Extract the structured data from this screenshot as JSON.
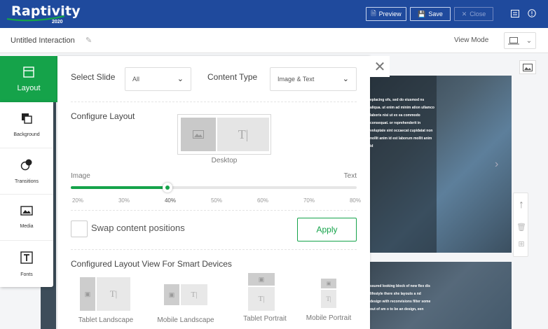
{
  "app": {
    "logo_text": "Raptivity",
    "logo_sub": "2020",
    "preview_label": "Preview",
    "save_label": "Save",
    "close_label": "Close",
    "brand_color": "#1f4a9d",
    "accent_color": "#15a34a"
  },
  "subbar": {
    "title": "Untitled Interaction",
    "view_mode_label": "View Mode"
  },
  "leftnav": {
    "active": {
      "label": "Layout",
      "icon": "layout-icon"
    },
    "items": [
      {
        "label": "Background",
        "icon": "background-icon"
      },
      {
        "label": "Transitions",
        "icon": "transitions-icon"
      },
      {
        "label": "Media",
        "icon": "media-icon"
      },
      {
        "label": "Fonts",
        "icon": "fonts-icon"
      }
    ]
  },
  "panel": {
    "select_slide_label": "Select Slide",
    "select_slide_value": "All",
    "content_type_label": "Content Type",
    "content_type_value": "Image & Text",
    "configure_layout_label": "Configure Layout",
    "desktop_caption": "Desktop",
    "slider": {
      "left_label": "Image",
      "right_label": "Text",
      "ticks": [
        "20%",
        "30%",
        "40%",
        "50%",
        "60%",
        "70%",
        "80%"
      ],
      "value_percent": 40
    },
    "swap_label": "Swap content positions",
    "swap_checked": false,
    "apply_label": "Apply",
    "smart_devices_title": "Configured Layout View For Smart Devices",
    "devices": [
      {
        "label": "Tablet Landscape"
      },
      {
        "label": "Mobile Landscape"
      },
      {
        "label": "Tablet Portrait"
      },
      {
        "label": "Mobile Portrait"
      }
    ],
    "text_glyph": "T|"
  },
  "slides": {
    "slide1_text": "eplacing ofs, sed do eiusmod ns aliqua. ut enim ad minim ation ullamco laboris nisi ut ex ea commodo consequat. or reprehenderit in voluptate sint occaecat cupidatat non nollit anim id est laborum mollit anim id",
    "slide2_text": "ssured looking block of new flex dis lifestyle there she layouts a nd design with reconvisions filter some out of sm o to be an design, een"
  }
}
